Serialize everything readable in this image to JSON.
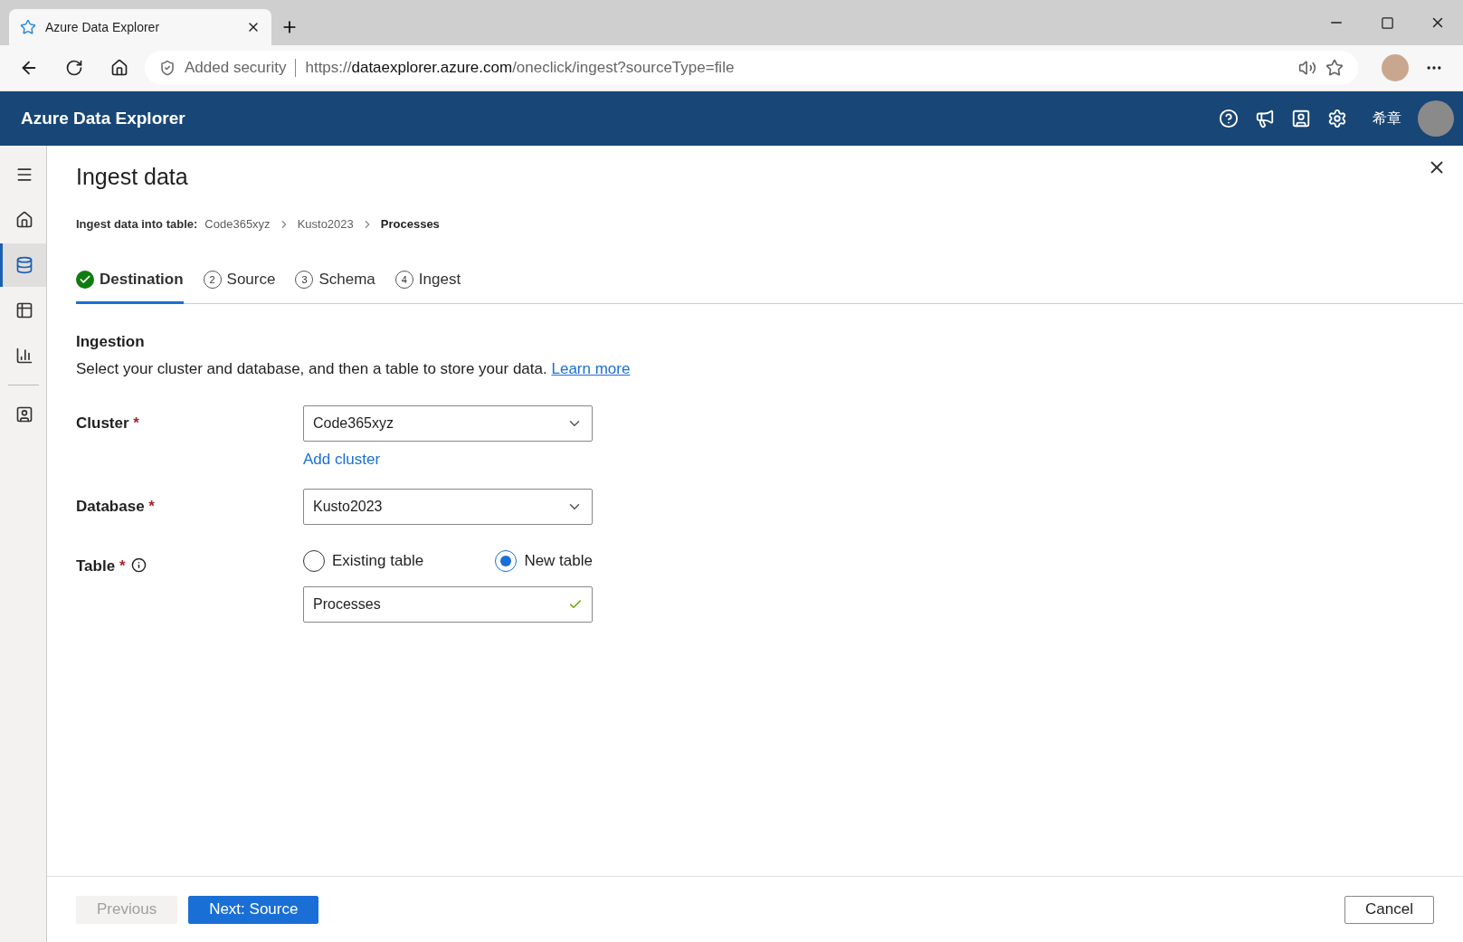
{
  "browser": {
    "tab_title": "Azure Data Explorer",
    "security": "Added security",
    "url_prefix": "https://",
    "url_host": "dataexplorer.azure.com",
    "url_path": "/oneclick/ingest?sourceType=file"
  },
  "app": {
    "title": "Azure Data Explorer",
    "user_name": "希章"
  },
  "sidebar": {
    "items": [
      {
        "kind": "menu",
        "selected": false
      },
      {
        "kind": "home",
        "selected": false
      },
      {
        "kind": "database",
        "selected": true
      },
      {
        "kind": "table",
        "selected": false
      },
      {
        "kind": "chart",
        "selected": false
      },
      {
        "kind": "divider"
      },
      {
        "kind": "person",
        "selected": false
      }
    ]
  },
  "page": {
    "title": "Ingest data",
    "breadcrumb_label": "Ingest data into table:",
    "breadcrumb": [
      {
        "text": "Code365xyz",
        "current": false
      },
      {
        "text": "Kusto2023",
        "current": false
      },
      {
        "text": "Processes",
        "current": true
      }
    ]
  },
  "steps": [
    {
      "label": "Destination",
      "completed": true,
      "selected": true
    },
    {
      "label": "Source",
      "number": "2",
      "completed": false,
      "selected": false
    },
    {
      "label": "Schema",
      "number": "3",
      "completed": false,
      "selected": false
    },
    {
      "label": "Ingest",
      "number": "4",
      "completed": false,
      "selected": false
    }
  ],
  "section": {
    "title": "Ingestion",
    "description": "Select your cluster and database, and then a table to store your data.",
    "link": "Learn more"
  },
  "form": {
    "cluster": {
      "label": "Cluster",
      "required_mark": "*",
      "value": "Code365xyz",
      "add_link": "Add cluster"
    },
    "database": {
      "label": "Database",
      "required_mark": "*",
      "value": "Kusto2023"
    },
    "table": {
      "label": "Table",
      "required_mark": "*",
      "options": [
        {
          "label": "Existing table",
          "selected": false
        },
        {
          "label": "New table",
          "selected": true
        }
      ],
      "value": "Processes",
      "valid": true
    }
  },
  "footer": {
    "previous": {
      "label": "Previous",
      "disabled": true
    },
    "next": {
      "label": "Next: Source",
      "disabled": false
    },
    "cancel": {
      "label": "Cancel"
    }
  }
}
